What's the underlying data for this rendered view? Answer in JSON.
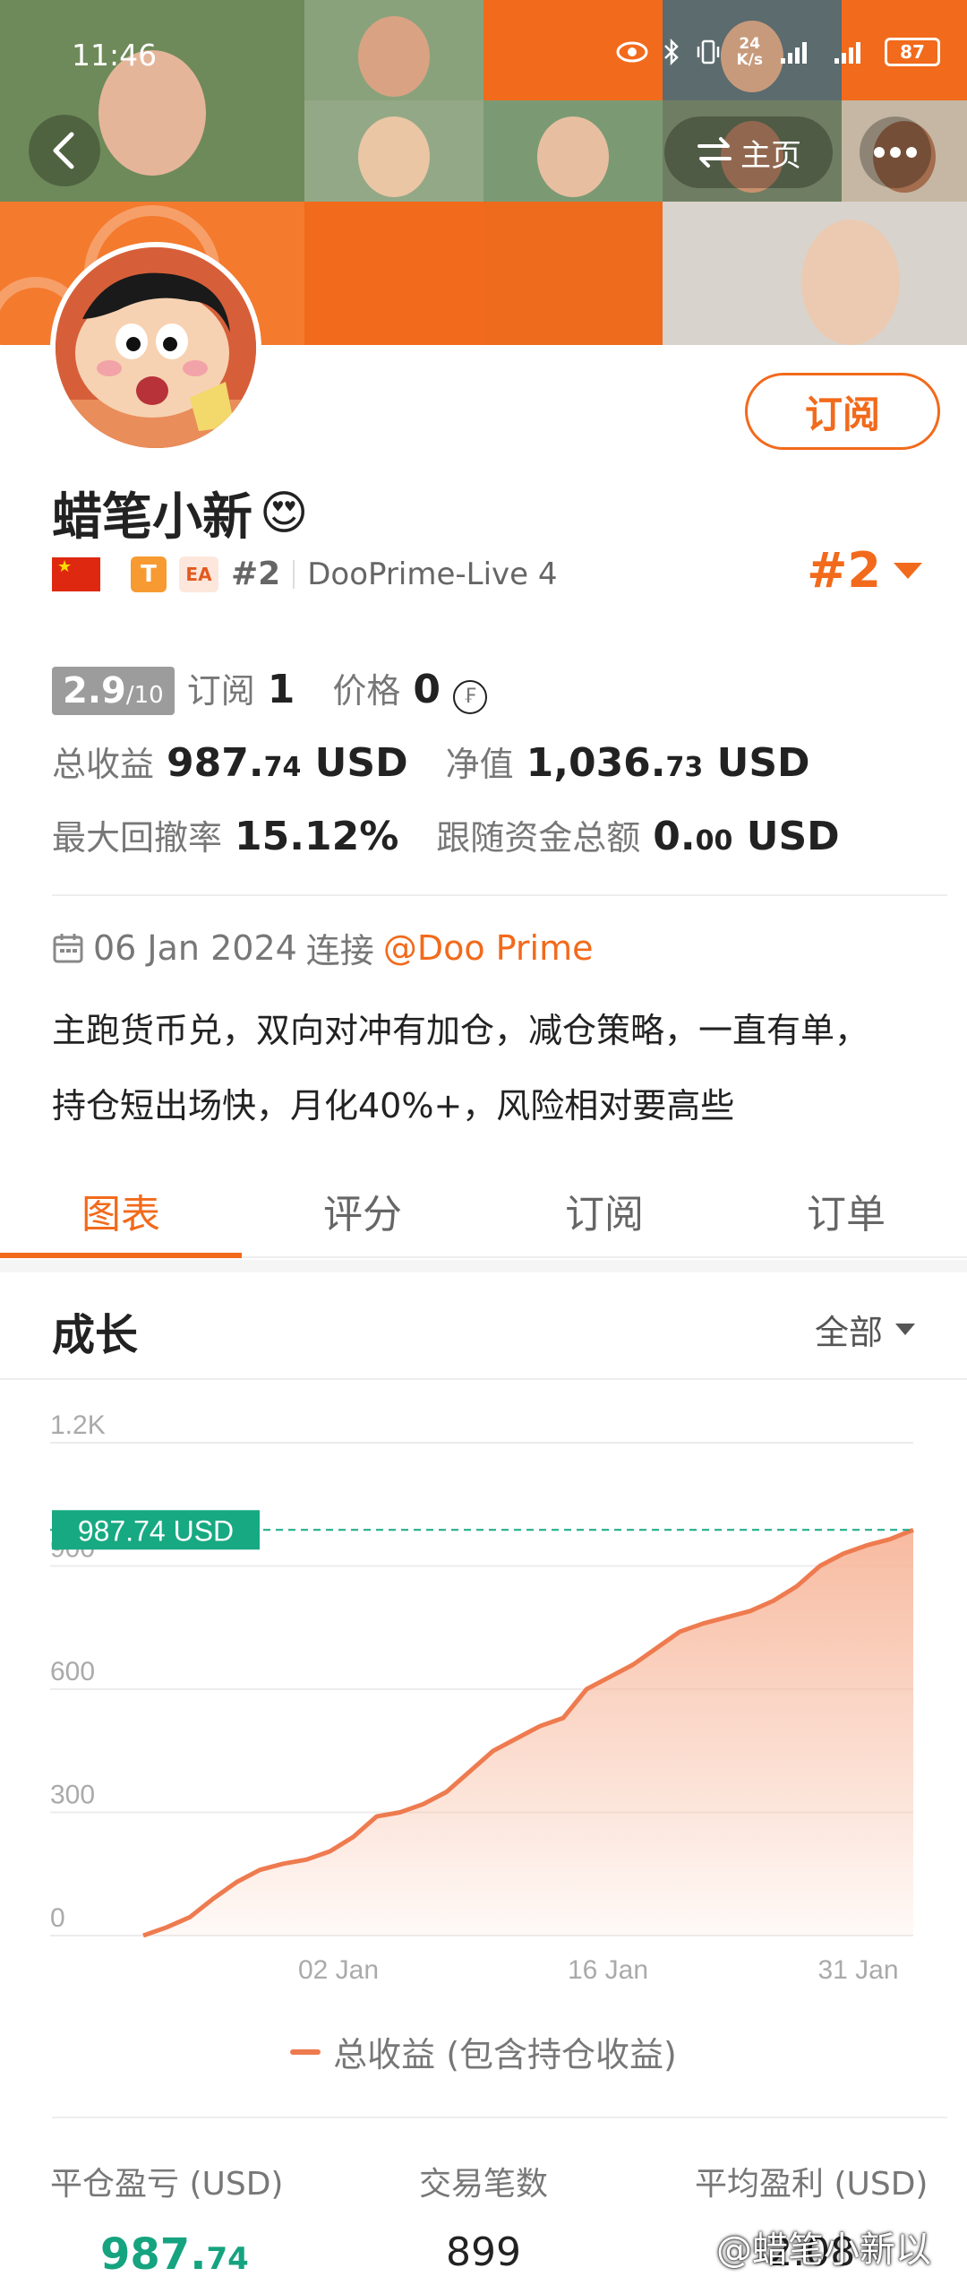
{
  "status_bar": {
    "time": "11:46",
    "net_speed": "24\nK/s",
    "battery": "87"
  },
  "header": {
    "home_label": "主页"
  },
  "profile": {
    "name": "蜡笔小新",
    "name_emoji": "😍",
    "subscribe_label": "订阅",
    "badge_t": "T",
    "badge_ea": "EA",
    "rank_small": "#2",
    "server": "DooPrime-Live 4",
    "rank_big": "#2"
  },
  "stats": {
    "score": "2.9",
    "score_max": "/10",
    "subscribe_label": "订阅",
    "subscribe_count": "1",
    "price_label": "价格",
    "price_value": "0",
    "price_icon": "coin-icon",
    "total_profit_label": "总收益",
    "total_profit_int": "987.",
    "total_profit_dec": "74",
    "total_profit_unit": "USD",
    "equity_label": "净值",
    "equity_int": "1,036.",
    "equity_dec": "73",
    "equity_unit": "USD",
    "drawdown_label": "最大回撤率",
    "drawdown_value": "15.12%",
    "follow_funds_label": "跟随资金总额",
    "follow_funds_int": "0.",
    "follow_funds_dec": "00",
    "follow_funds_unit": "USD"
  },
  "join": {
    "date": "06 Jan 2024",
    "connect_label": "连接",
    "broker": "@Doo Prime"
  },
  "description": {
    "line1": "主跑货币兑，双向对冲有加仓，减仓策略，一直有单，",
    "line2": "持仓短出场快，月化40%+，风险相对要高些"
  },
  "tabs": [
    {
      "label": "图表",
      "active": true
    },
    {
      "label": "评分",
      "active": false
    },
    {
      "label": "订阅",
      "active": false
    },
    {
      "label": "订单",
      "active": false
    }
  ],
  "growth": {
    "title": "成长",
    "filter": "全部"
  },
  "chart_data": {
    "type": "area",
    "title": "",
    "ylabel": "",
    "xlabel": "",
    "ylim": [
      0,
      1200
    ],
    "yticks": [
      "0",
      "300",
      "600",
      "900",
      "1.2K"
    ],
    "ytick_values": [
      0,
      300,
      600,
      900,
      1200
    ],
    "xticks": [
      "02 Jan",
      "16 Jan",
      "31 Jan"
    ],
    "current_label": "987.74 USD",
    "current_value": 987.74,
    "legend": "总收益 (包含持仓收益)",
    "series": [
      {
        "name": "总收益 (包含持仓收益)",
        "values": [
          0,
          20,
          45,
          90,
          130,
          160,
          175,
          185,
          205,
          240,
          290,
          300,
          320,
          350,
          400,
          450,
          480,
          510,
          530,
          600,
          630,
          660,
          700,
          740,
          760,
          775,
          790,
          815,
          850,
          900,
          930,
          950,
          965,
          987.74
        ]
      }
    ],
    "colors": {
      "line": "#ee7b4f",
      "fill": "#f7b79b",
      "marker": "#17a982"
    }
  },
  "bottom_stats": {
    "closed_pnl_label": "平仓盈亏 (USD)",
    "closed_pnl_int": "987.",
    "closed_pnl_dec": "74",
    "trades_label": "交易笔数",
    "trades_value": "899",
    "avg_profit_label": "平均盈利 (USD)",
    "avg_profit_value": "2.08"
  },
  "watermark": "@蜡笔小新以",
  "colors": {
    "accent": "#f26a1b",
    "green": "#16a37f"
  }
}
